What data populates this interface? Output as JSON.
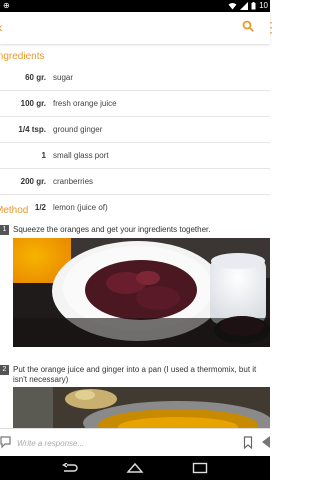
{
  "status": {
    "time": "10"
  },
  "ingredients_title": "Ingredients",
  "ingredients": [
    {
      "qty": "60 gr.",
      "name": "sugar"
    },
    {
      "qty": "100 gr.",
      "name": "fresh orange juice"
    },
    {
      "qty": "1/4 tsp.",
      "name": "ground ginger"
    },
    {
      "qty": "1",
      "name": "small glass port"
    },
    {
      "qty": "200 gr.",
      "name": "cranberries"
    },
    {
      "qty": "1/2",
      "name": "lemon (juice of)"
    }
  ],
  "method_title": "Method",
  "steps": [
    {
      "num": "1",
      "text": "Squeeze the oranges and get your ingredients together."
    },
    {
      "num": "2",
      "text_line1": "Put the orange juice and ginger into a pan (I used a thermomix, but it",
      "text_line2": "isn't necessary)"
    }
  ],
  "composer": {
    "placeholder": "Write a response..."
  },
  "colors": {
    "accent": "#e99a2b"
  },
  "icons": [
    "back-icon",
    "search-icon",
    "more-icon",
    "comment-icon",
    "bookmark-icon",
    "share-icon",
    "nav-back-icon",
    "nav-home-icon",
    "nav-recents-icon"
  ]
}
